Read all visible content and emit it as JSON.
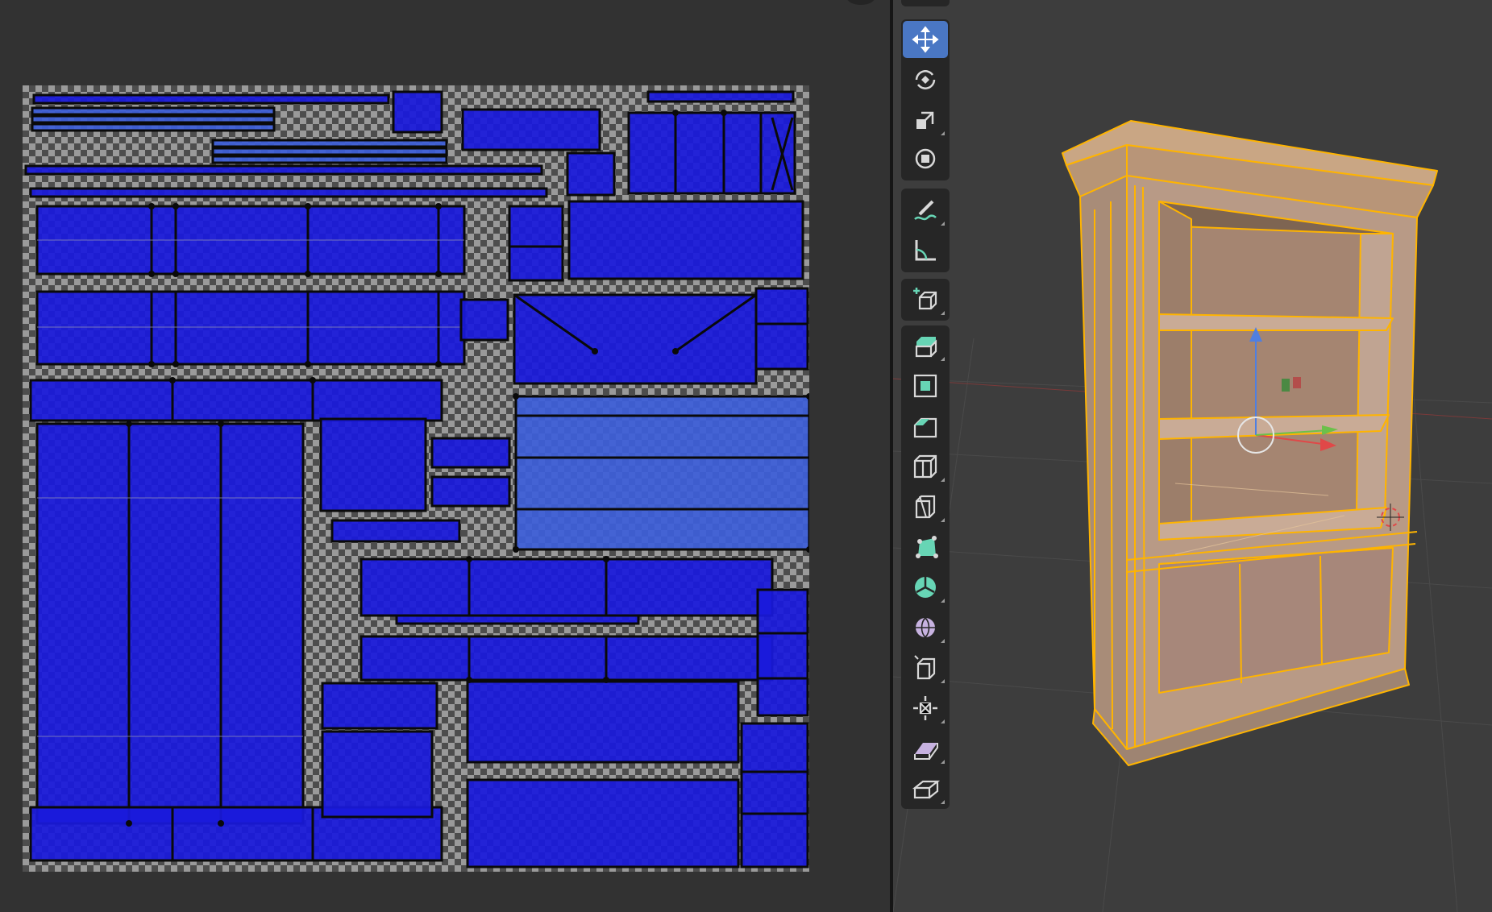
{
  "uv_editor": {
    "background": "#323232",
    "island_color": "#1a1adb",
    "checker_light": "#9a9a9a",
    "checker_dark": "#4d4d4d"
  },
  "viewport": {
    "background": "#3d3d3d",
    "selection_color": "#ffb400",
    "object_color": "#a58a78"
  },
  "toolbar": {
    "active_tool": "move",
    "tools": [
      {
        "name": "move",
        "icon": "move-icon"
      },
      {
        "name": "rotate",
        "icon": "rotate-icon"
      },
      {
        "name": "scale",
        "icon": "scale-icon"
      },
      {
        "name": "transform",
        "icon": "transform-icon"
      },
      {
        "name": "annotate",
        "icon": "annotate-icon"
      },
      {
        "name": "measure",
        "icon": "measure-icon"
      },
      {
        "name": "add-cube",
        "icon": "add-cube-icon"
      },
      {
        "name": "extrude-region",
        "icon": "extrude-region-icon"
      },
      {
        "name": "inset-faces",
        "icon": "inset-faces-icon"
      },
      {
        "name": "bevel",
        "icon": "bevel-icon"
      },
      {
        "name": "loop-cut",
        "icon": "loop-cut-icon"
      },
      {
        "name": "knife",
        "icon": "knife-icon"
      },
      {
        "name": "poly-build",
        "icon": "poly-build-icon"
      },
      {
        "name": "spin",
        "icon": "spin-icon"
      },
      {
        "name": "smooth",
        "icon": "smooth-icon"
      },
      {
        "name": "edge-slide",
        "icon": "edge-slide-icon"
      },
      {
        "name": "shrink-fatten",
        "icon": "shrink-fatten-icon"
      },
      {
        "name": "shear",
        "icon": "shear-icon"
      },
      {
        "name": "rip-region",
        "icon": "rip-region-icon"
      }
    ]
  }
}
